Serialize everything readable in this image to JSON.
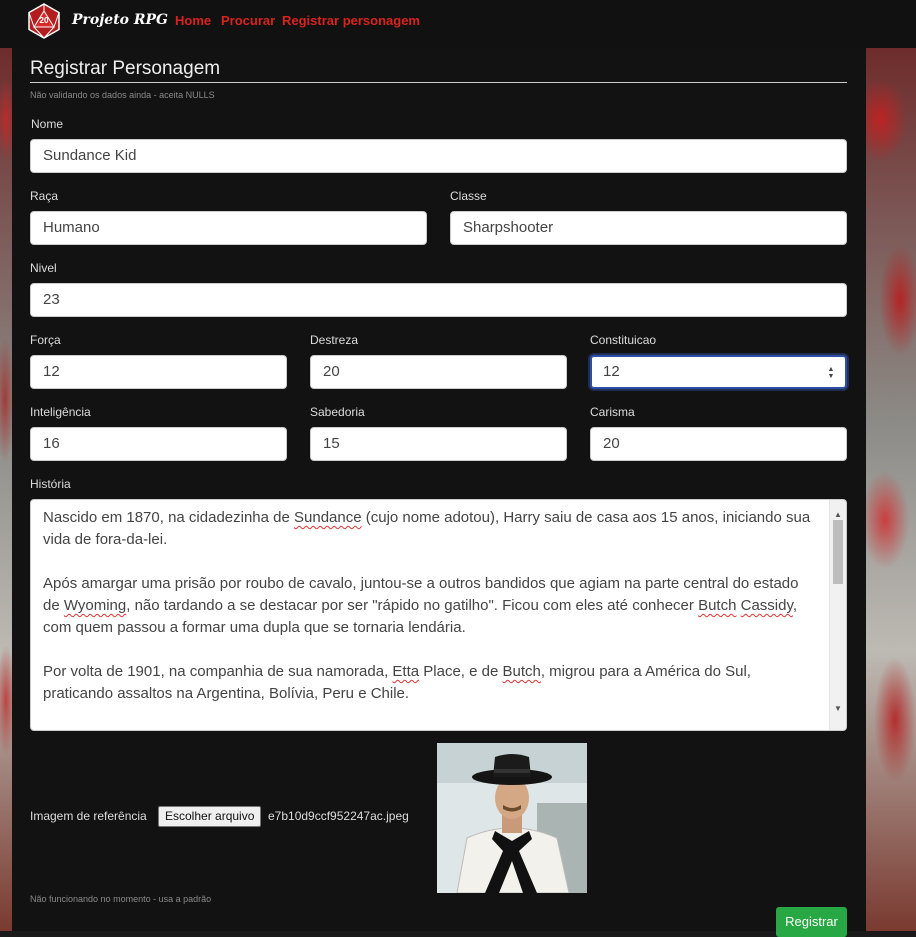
{
  "nav": {
    "brand": "Projeto RPG",
    "logo_number": "20",
    "links": [
      "Home",
      "Procurar",
      "Registrar personagem"
    ]
  },
  "form": {
    "title": "Registrar Personagem",
    "subtitle_hint": "Não validando os dados ainda - aceita NULLS",
    "fields": {
      "nome": {
        "label": "Nome",
        "value": "Sundance Kid"
      },
      "raca": {
        "label": "Raça",
        "value": "Humano"
      },
      "classe": {
        "label": "Classe",
        "value": "Sharpshooter"
      },
      "nivel": {
        "label": "Nivel",
        "value": "23"
      },
      "forca": {
        "label": "Força",
        "value": "12"
      },
      "destreza": {
        "label": "Destreza",
        "value": "20"
      },
      "constituicao": {
        "label": "Constituicao",
        "value": "12"
      },
      "inteligencia": {
        "label": "Inteligência",
        "value": "16"
      },
      "sabedoria": {
        "label": "Sabedoria",
        "value": "15"
      },
      "carisma": {
        "label": "Carisma",
        "value": "20"
      }
    },
    "historia": {
      "label": "História",
      "p1_a": " Nascido em 1870, na cidadezinha de ",
      "p1_b": "Sundance",
      "p1_c": " (cujo nome adotou), Harry saiu de casa aos 15 anos, iniciando sua vida de fora-da-lei.",
      "p2_a": "Após amargar uma prisão por roubo de cavalo, juntou-se a outros bandidos que agiam na parte central do estado de ",
      "p2_b": "Wyoming",
      "p2_c": ", não tardando a se destacar por ser \"rápido no gatilho\". Ficou com eles até conhecer ",
      "p2_d": "Butch",
      "p2_e": " ",
      "p2_f": "Cassidy",
      "p2_g": ", com quem passou a formar uma dupla que se tornaria lendária.",
      "p3_a": "Por volta de 1901, na companhia de sua namorada, ",
      "p3_b": "Etta",
      "p3_c": " Place, e de ",
      "p3_d": "Butch",
      "p3_e": ", migrou para a América do Sul, praticando assaltos na Argentina, Bolívia, Peru e Chile."
    },
    "image": {
      "label": "Imagem de referência",
      "button": "Escolher arquivo",
      "filename": "e7b10d9ccf952247ac.jpeg",
      "hint": "Não funcionando no momento - usa a padrão"
    },
    "submit": "Registrar"
  },
  "colors": {
    "nav_link": "#d9231d",
    "submit": "#28a745",
    "panel": "#121212"
  }
}
